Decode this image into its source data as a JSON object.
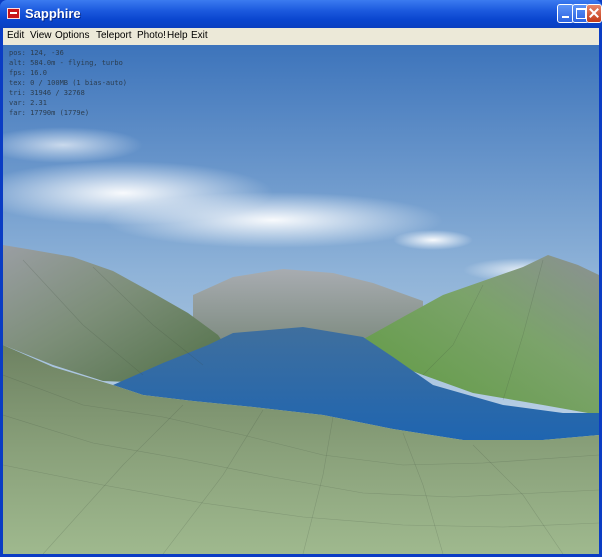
{
  "window": {
    "title": "Sapphire",
    "controls": [
      "minimize-icon",
      "maximize-icon",
      "close-icon"
    ],
    "accent": "#0a46cf"
  },
  "menu": [
    "Edit",
    "View",
    "Options",
    "Teleport",
    "Photo!",
    "Help",
    "Exit"
  ],
  "hud": [
    "pos: 124, -36",
    "alt: 584.0m - flying, turbo",
    "fps: 16.0",
    "tex: 0 / 100MB (1 bias-auto)",
    "tri: 31946 / 32768",
    "var: 2.31",
    "far: 17790m (1779e)"
  ],
  "scene": {
    "sky_top": "#4f84c4",
    "sky_horizon": "#dfe8ef",
    "water": "#2a6ab0",
    "grass": "#6f9a58",
    "rock": "#8e959c"
  }
}
